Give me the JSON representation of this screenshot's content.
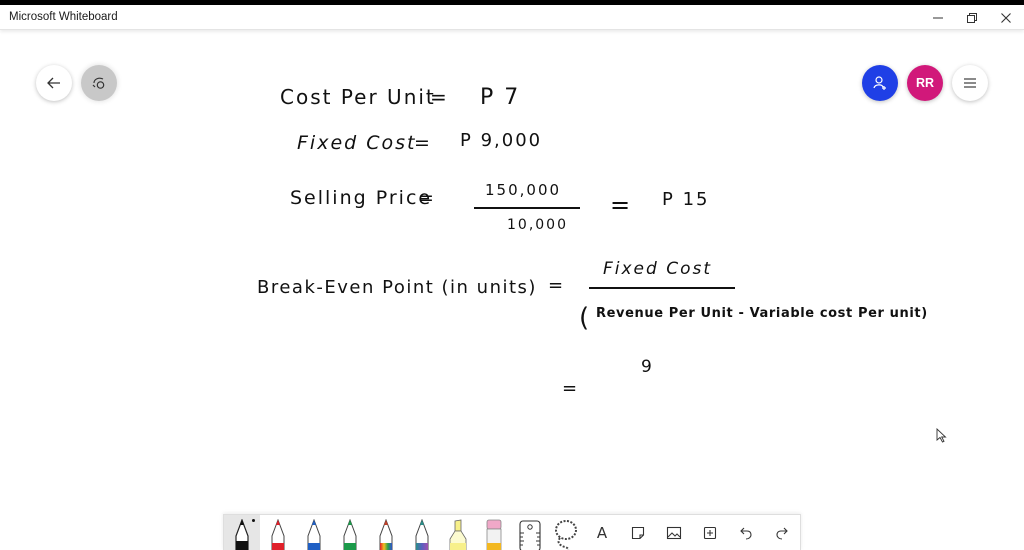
{
  "window": {
    "title": "Microsoft Whiteboard",
    "controls": {
      "minimize": "minimize-icon",
      "maximize": "restore-icon",
      "close": "close-icon"
    }
  },
  "top_left_buttons": [
    {
      "name": "back",
      "icon": "arrow-left-icon"
    },
    {
      "name": "share-board",
      "icon": "camera-ink-icon"
    }
  ],
  "top_right_buttons": [
    {
      "name": "invite",
      "icon": "add-person-icon",
      "color": "#1f3fe6"
    },
    {
      "name": "account",
      "initials": "RR",
      "color": "#d1187a"
    },
    {
      "name": "settings-menu",
      "icon": "hamburger-icon"
    }
  ],
  "board": {
    "line1": {
      "label": "Cost Per Unit",
      "eq": "=",
      "value": "P 7"
    },
    "line2": {
      "label": "Fixed Cost",
      "eq": "=",
      "value": "P 9,000"
    },
    "line3": {
      "label": "Selling Price",
      "eq": "=",
      "numerator": "150,000",
      "denominator": "10,000",
      "eq2": "=",
      "value": "P 15"
    },
    "line4": {
      "label": "Break-Even Point (in units)",
      "eq": "=",
      "numerator": "Fixed Cost",
      "denominator_open": "(",
      "denominator": "Revenue Per Unit - Variable cost Per unit)"
    },
    "line5": {
      "eq": "=",
      "numerator": "9"
    }
  },
  "toolbar": {
    "tools": [
      {
        "name": "pen-black",
        "color": "#111111",
        "active": true
      },
      {
        "name": "pen-red",
        "color": "#e0202a"
      },
      {
        "name": "pen-blue",
        "color": "#1f5fc4"
      },
      {
        "name": "pen-green",
        "color": "#1b9a4a"
      },
      {
        "name": "pen-rainbow",
        "color": "#e8702a"
      },
      {
        "name": "pen-galaxy",
        "color": "#2a8f8a"
      },
      {
        "name": "highlighter",
        "color": "#f7f08a"
      },
      {
        "name": "eraser",
        "color": "#f0a8c8"
      },
      {
        "name": "ruler",
        "icon": "ruler-icon"
      },
      {
        "name": "lasso",
        "icon": "lasso-icon"
      },
      {
        "name": "text",
        "icon": "text-icon",
        "glyph": "A"
      },
      {
        "name": "sticky-note",
        "icon": "note-icon"
      },
      {
        "name": "image",
        "icon": "image-icon"
      },
      {
        "name": "insert",
        "icon": "add-box-icon"
      },
      {
        "name": "undo",
        "icon": "undo-icon"
      },
      {
        "name": "redo",
        "icon": "redo-icon"
      }
    ]
  }
}
